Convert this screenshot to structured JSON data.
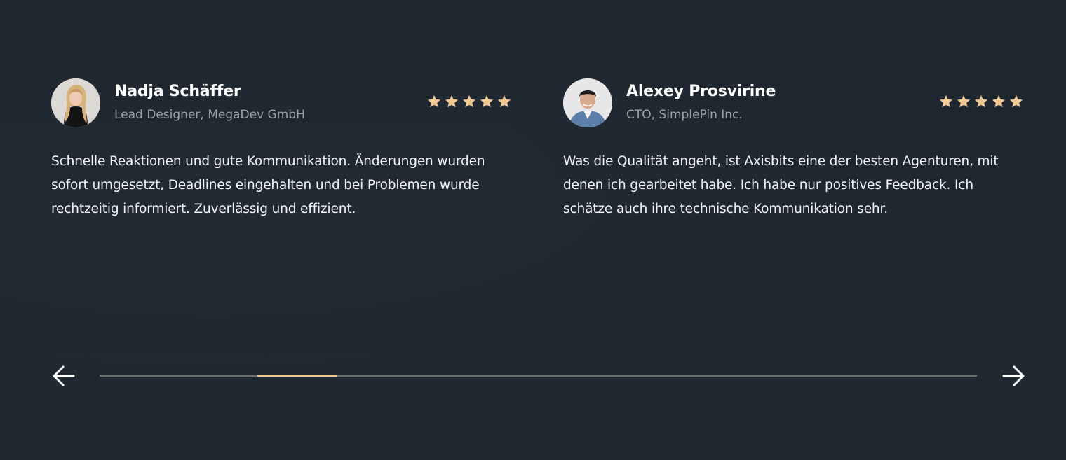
{
  "testimonials": [
    {
      "name": "Nadja Schäffer",
      "role": "Lead Designer, MegaDev GmbH",
      "rating": 5,
      "text": "Schnelle Reaktionen und gute Kommunikation. Änderungen wurden sofort umgesetzt, Deadlines eingehalten und bei Problemen wurde rechtzeitig informiert. Zuverlässig und effizient."
    },
    {
      "name": "Alexey Prosvirine",
      "role": "CTO, SimplePin Inc.",
      "rating": 5,
      "text": "Was die Qualität angeht, ist Axisbits eine der besten Agenturen, mit denen ich gearbeitet habe. Ich habe nur positives Feedback. Ich schätze auch ihre technische Kommunikation sehr."
    }
  ],
  "slider": {
    "progress_fraction_start": 0.18,
    "progress_fraction_end": 0.27
  },
  "colors": {
    "background": "#1f2731",
    "star": "#f1c793",
    "progress_active": "#f1c793",
    "progress_track": "#6b6f70"
  },
  "icons": {
    "prev": "arrow-left-icon",
    "next": "arrow-right-icon",
    "rating": "star-icon"
  }
}
